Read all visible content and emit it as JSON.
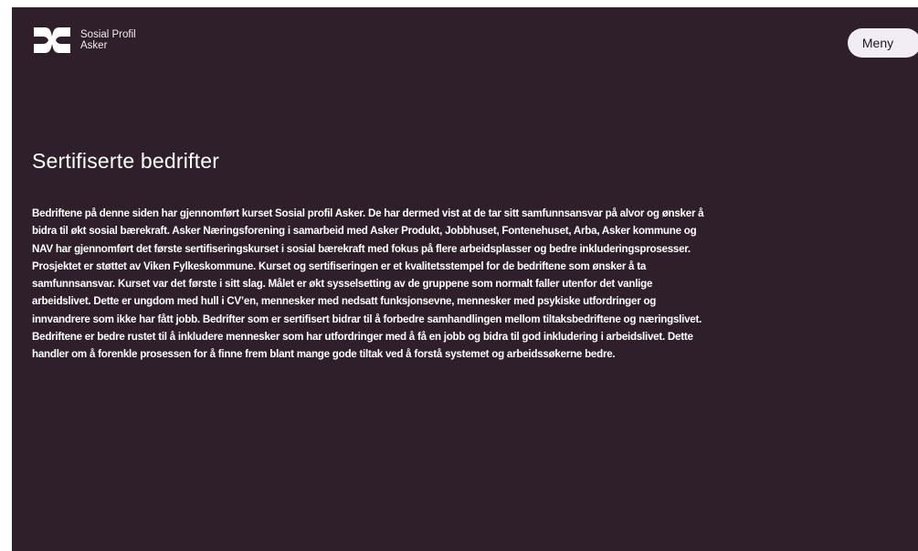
{
  "header": {
    "logo_line1": "Sosial Profil",
    "logo_line2": "Asker",
    "logo_icon": "sosial-profil-logo-icon",
    "menu_label": "Meny"
  },
  "main": {
    "title": "Sertifiserte bedrifter",
    "body": "Bedriftene på denne siden har gjennomført kurset Sosial profil Asker. De har dermed vist at de tar sitt samfunnsansvar på alvor og ønsker å bidra til økt sosial bærekraft. Asker Næringsforening i samarbeid med Asker Produkt, Jobbhuset, Fontenehuset, Arba, Asker kommune og NAV har gjennomført det første sertifiseringskurset i sosial bærekraft med fokus på flere arbeidsplasser og bedre inkluderingsprosesser. Prosjektet er støttet av Viken Fylkeskommune. Kurset og sertifiseringen er et kvalitetsstempel for de bedriftene som ønsker å ta samfunnsansvar.   Kurset var det første i sitt slag. Målet er økt sysselsetting av de gruppene som normalt faller utenfor det vanlige arbeidslivet. Dette er ungdom med hull i CV’en, mennesker med nedsatt funksjonsevne, mennesker med psykiske utfordringer og innvandrere som ikke har fått jobb. Bedrifter som er sertifisert bidrar til å forbedre samhandlingen mellom tiltaksbedriftene og næringslivet. Bedriftene er bedre rustet til å inkludere mennesker som har utfordringer med å få en jobb og bidra til god inkludering i arbeidslivet. Dette handler om å forenkle prosessen for å finne frem blant mange gode tiltak ved å forstå systemet og arbeidssøkerne bedre."
  },
  "colors": {
    "background": "#2e1f2b",
    "text": "#ffffff",
    "menu_button_bg": "#f2ecf4"
  }
}
